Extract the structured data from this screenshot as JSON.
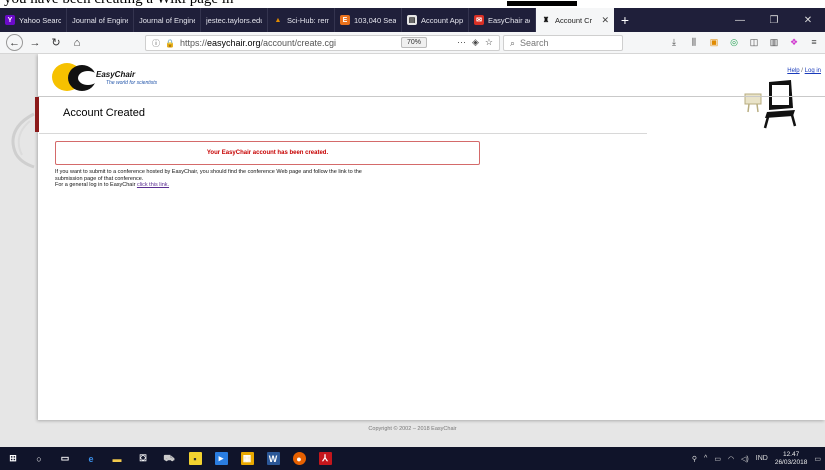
{
  "doc_strip": {
    "text": "you have been creating a Wiki page in"
  },
  "tabs": [
    {
      "label": "Yahoo Search",
      "icon": "yahoo-icon",
      "color": "#6b0ac9",
      "glyph": "Y"
    },
    {
      "label": "Journal of Engineer",
      "icon": "journal-icon",
      "color": "#1f1f3a",
      "glyph": ""
    },
    {
      "label": "Journal of Enginee",
      "icon": "journal-icon",
      "color": "#1f1f3a",
      "glyph": ""
    },
    {
      "label": "jestec.taylors.edu.m",
      "icon": "page-icon",
      "color": "#1f1f3a",
      "glyph": ""
    },
    {
      "label": "Sci-Hub: remov",
      "icon": "scihub-icon",
      "color": "#e08a00",
      "glyph": "▲"
    },
    {
      "label": "103,040 Search",
      "icon": "elsevier-icon",
      "color": "#e9711c",
      "glyph": "E"
    },
    {
      "label": "Account Applic",
      "icon": "account-icon",
      "color": "#3a3a3a",
      "glyph": "▤"
    },
    {
      "label": "EasyChair acco",
      "icon": "mail-icon",
      "color": "#d93025",
      "glyph": "✉"
    }
  ],
  "active_tab": {
    "label": "Account Cr",
    "icon": "easychair-chair-icon"
  },
  "nav": {
    "url_prefix": "https://",
    "url_domain": "easychair.org",
    "url_path": "/account/create.cgi",
    "zoom": "70%",
    "search_placeholder": "Search"
  },
  "page": {
    "brand": "EasyChair",
    "tagline": "The world for scientists",
    "help_link": "Help",
    "login_link": "Log in",
    "separator": " / ",
    "title": "Account Created",
    "message": "Your EasyChair account has been created.",
    "body_line1": "If you want to submit to a conference hosted by EasyChair, you should find the conference Web page and follow the link to the",
    "body_line2": "submission page of that conference.",
    "body_line3_prefix": "For a general log in to EasyChair ",
    "body_link": "click this link.",
    "footer": "Copyright © 2002 – 2018 EasyChair"
  },
  "taskbar": {
    "lang": "IND",
    "time": "12.47",
    "date": "26/03/2018"
  },
  "colors": {
    "accent_red": "#c60000",
    "title_bar": "#8b1a1a",
    "logo_yellow": "#f6c100"
  }
}
